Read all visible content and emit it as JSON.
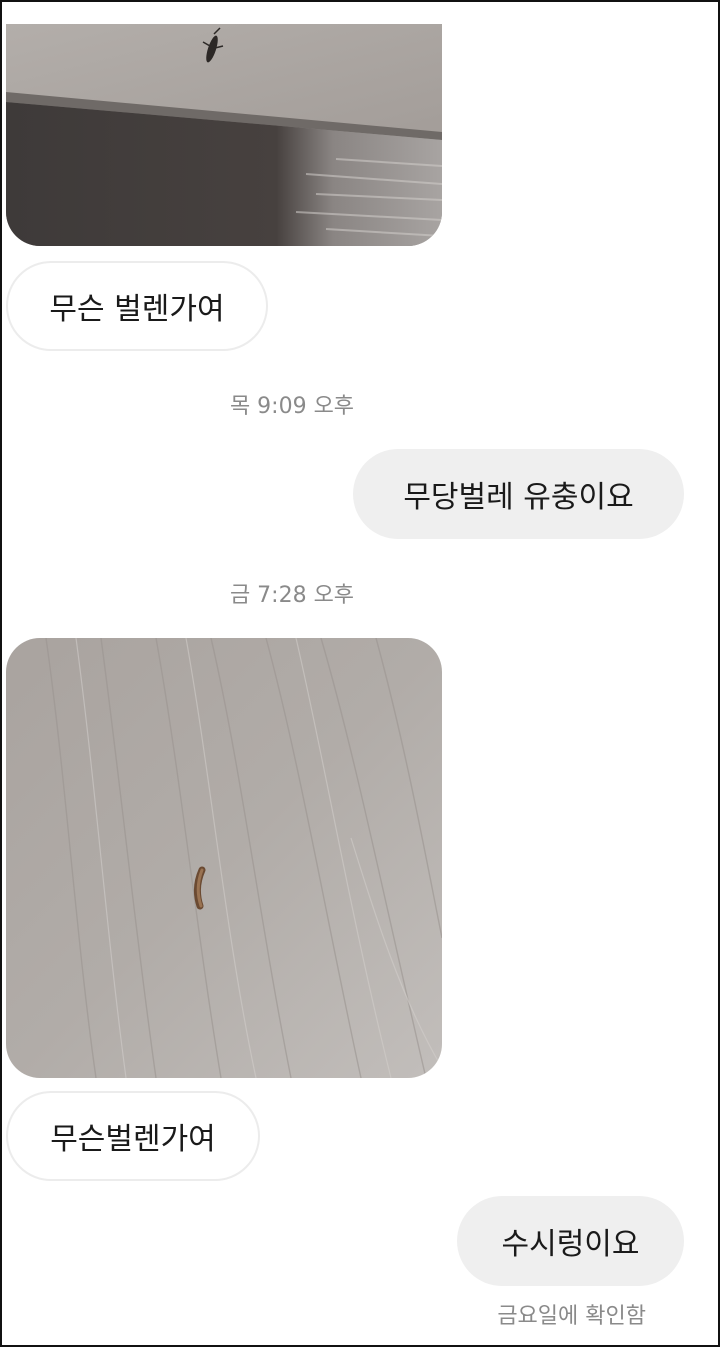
{
  "messages": {
    "m1": "무슨 벌렌가여",
    "timestamp1": "목 9:09 오후",
    "m2": "무당벌레 유충이요",
    "timestamp2": "금 7:28 오후",
    "m3": "무슨벌렌가여",
    "m4": "수시렁이요",
    "read_receipt": "금요일에 확인함"
  },
  "colors": {
    "page_background": "#ffffff",
    "outgoing_bubble": "#efefef",
    "incoming_bubble_border": "#ececec",
    "meta_text": "#8a8a8a",
    "frame_border": "#111111"
  }
}
